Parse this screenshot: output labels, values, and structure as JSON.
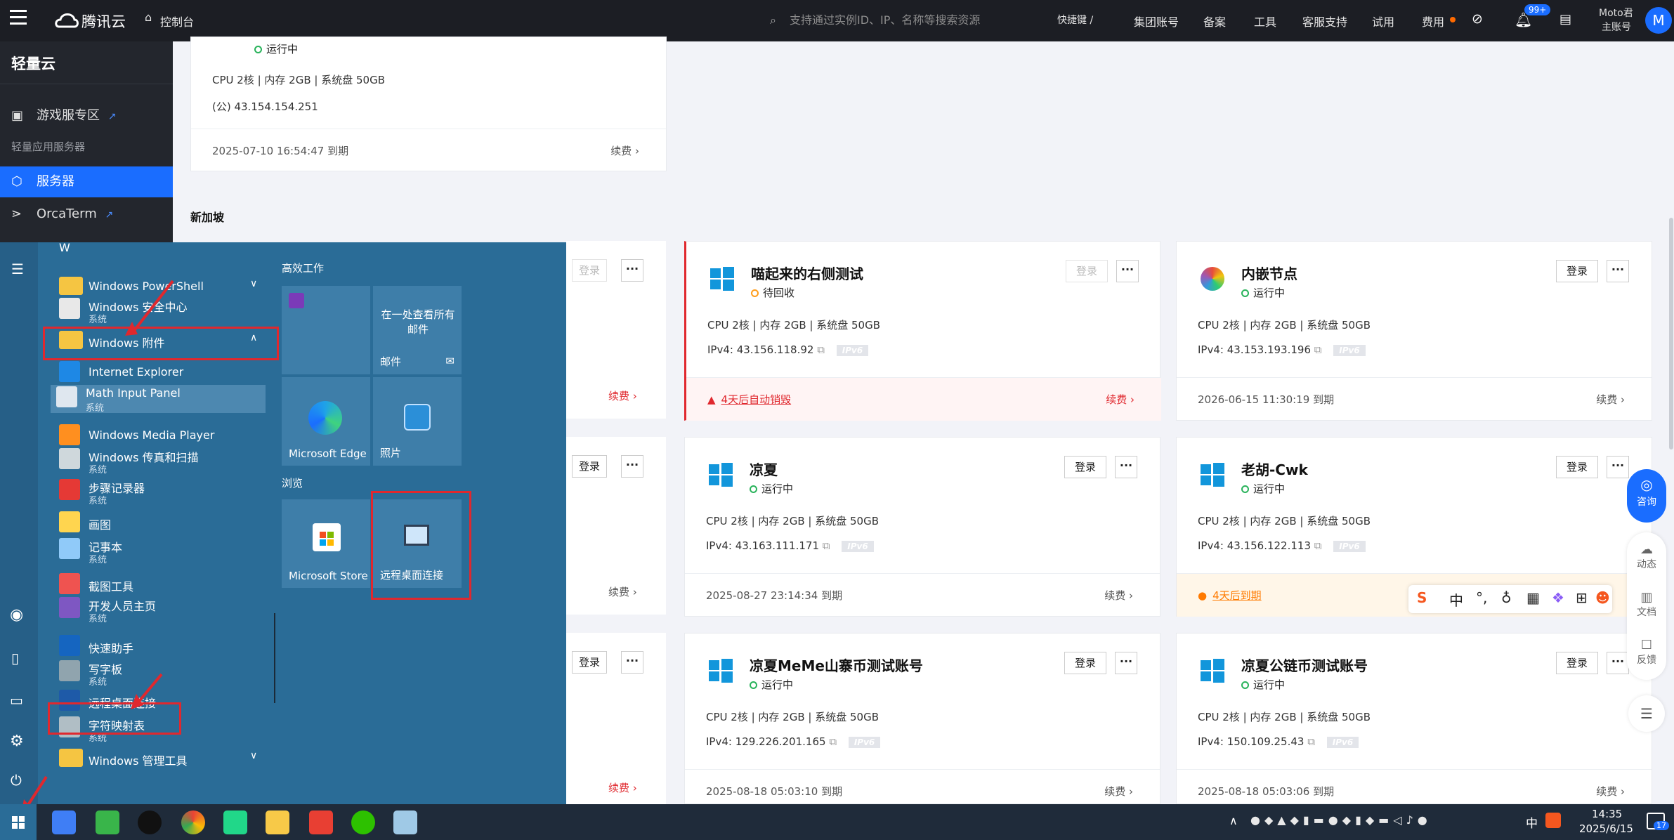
{
  "topbar": {
    "brand": "腾讯云",
    "console": "控制台",
    "search_placeholder": "支持通过实例ID、IP、名称等搜索资源",
    "shortcut": "快捷键 /",
    "nav": [
      "集团账号",
      "备案",
      "工具",
      "客服支持",
      "试用",
      "费用"
    ],
    "badge": "99+",
    "user_name": "Moto君",
    "user_role": "主账号",
    "avatar": "M"
  },
  "sidebar": {
    "title": "轻量云",
    "items": [
      {
        "label": "游戏服专区"
      },
      {
        "label": "轻量应用服务器"
      },
      {
        "label": "服务器"
      },
      {
        "label": "OrcaTerm"
      }
    ]
  },
  "top_card": {
    "status": "运行中",
    "spec": "CPU 2核 | 内存 2GB | 系统盘 50GB",
    "ip": "(公) 43.154.154.251",
    "expire": "2025-07-10 16:54:47 到期",
    "renew": "续费 ›"
  },
  "region": "新加坡",
  "cards": [
    {
      "title": "喵起来的右侧测试",
      "status": "待回收",
      "status_kind": "warn",
      "spec": "CPU 2核 | 内存 2GB | 系统盘 50GB",
      "ip": "IPv4: 43.156.118.92",
      "ipv6": "IPv6",
      "foot": "4天后自动销毁",
      "renew": "续费 ›",
      "login": "登录",
      "more": "···"
    },
    {
      "title": "内嵌节点",
      "status": "运行中",
      "status_kind": "ok",
      "spec": "CPU 2核 | 内存 2GB | 系统盘 50GB",
      "ip": "IPv4: 43.153.193.196",
      "ipv6": "IPv6",
      "foot": "2026-06-15 11:30:19 到期",
      "renew": "续费 ›",
      "login": "登录",
      "more": "···"
    },
    {
      "title": "凉夏",
      "status": "运行中",
      "status_kind": "ok",
      "spec": "CPU 2核 | 内存 2GB | 系统盘 50GB",
      "ip": "IPv4: 43.163.111.171",
      "ipv6": "IPv6",
      "foot": "2025-08-27 23:14:34 到期",
      "renew": "续费 ›",
      "login": "登录",
      "more": "···"
    },
    {
      "title": "老胡-Cwk",
      "status": "运行中",
      "status_kind": "ok",
      "spec": "CPU 2核 | 内存 2GB | 系统盘 50GB",
      "ip": "IPv4: 43.156.122.113",
      "ipv6": "IPv6",
      "foot": "4天后到期",
      "renew": "续费 ›",
      "login": "登录",
      "more": "···"
    },
    {
      "title": "凉夏MeMe山寨币测试账号",
      "status": "运行中",
      "status_kind": "ok",
      "spec": "CPU 2核 | 内存 2GB | 系统盘 50GB",
      "ip": "IPv4: 129.226.201.165",
      "ipv6": "IPv6",
      "foot": "2025-08-18 05:03:10 到期",
      "renew": "续费 ›",
      "login": "登录",
      "more": "···"
    },
    {
      "title": "凉夏公链币测试账号",
      "status": "运行中",
      "status_kind": "ok",
      "spec": "CPU 2核 | 内存 2GB | 系统盘 50GB",
      "ip": "IPv4: 150.109.25.43",
      "ipv6": "IPv6",
      "foot": "2025-08-18 05:03:06 到期",
      "renew": "续费 ›",
      "login": "登录",
      "more": "···"
    }
  ],
  "left_partial": {
    "login": "登录",
    "more": "···",
    "renew": "续费 ›"
  },
  "float": {
    "consult": "咨询",
    "dynamic": "动态",
    "docs": "文档",
    "feedback": "反馈"
  },
  "ime": [
    "中",
    "°,"
  ],
  "startmenu": {
    "letter": "W",
    "apps": [
      {
        "name": "Windows PowerShell",
        "sub": ""
      },
      {
        "name": "Windows 安全中心",
        "sub": "系统"
      },
      {
        "name": "Windows 附件",
        "sub": ""
      },
      {
        "name": "Internet Explorer",
        "sub": ""
      },
      {
        "name": "Math Input Panel",
        "sub": "系统"
      },
      {
        "name": "Windows Media Player",
        "sub": ""
      },
      {
        "name": "Windows 传真和扫描",
        "sub": "系统"
      },
      {
        "name": "步骤记录器",
        "sub": "系统"
      },
      {
        "name": "画图",
        "sub": ""
      },
      {
        "name": "记事本",
        "sub": "系统"
      },
      {
        "name": "截图工具",
        "sub": ""
      },
      {
        "name": "开发人员主页",
        "sub": "系统"
      },
      {
        "name": "快速助手",
        "sub": ""
      },
      {
        "name": "写字板",
        "sub": "系统"
      },
      {
        "name": "远程桌面连接",
        "sub": ""
      },
      {
        "name": "字符映射表",
        "sub": "系统"
      },
      {
        "name": "Windows 管理工具",
        "sub": ""
      }
    ],
    "group1": "高效工作",
    "group2": "浏览",
    "tiles": {
      "mail_text": "在一处查看所有邮件",
      "mail": "邮件",
      "edge": "Microsoft Edge",
      "photos": "照片",
      "store": "Microsoft Store",
      "rdp": "远程桌面连接"
    }
  },
  "taskbar": {
    "ime": "中",
    "time": "14:35",
    "date": "2025/6/15",
    "notif": "17"
  },
  "colors": {
    "accent": "#1a6dff",
    "danger": "#e0282e",
    "ok": "#29b35b",
    "warn": "#ff9c19"
  }
}
